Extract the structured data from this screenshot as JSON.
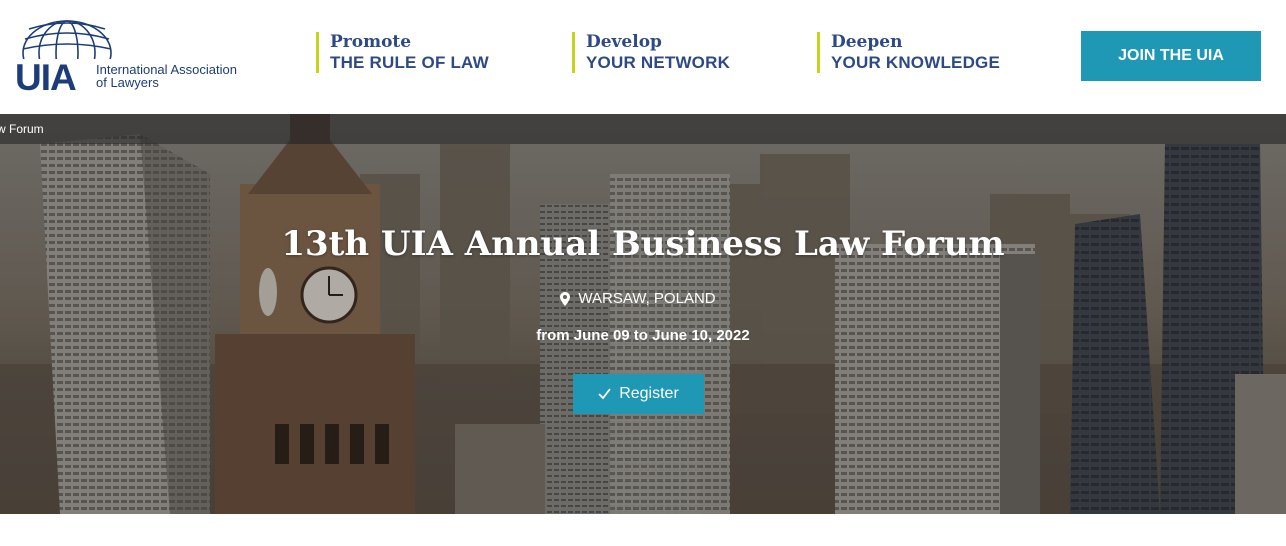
{
  "logo": {
    "acronym": "UIA",
    "name_line1": "International Association",
    "name_line2": "of Lawyers"
  },
  "pillars": [
    {
      "verb": "Promote",
      "object": "THE RULE OF LAW"
    },
    {
      "verb": "Develop",
      "object": "YOUR NETWORK"
    },
    {
      "verb": "Deepen",
      "object": "YOUR KNOWLEDGE"
    }
  ],
  "join_label": "JOIN THE UIA",
  "breadcrumb": "w Forum",
  "event": {
    "title": "13th UIA Annual Business Law Forum",
    "location": "WARSAW, POLAND",
    "dates": "from June 09 to June 10, 2022",
    "register_label": "Register"
  },
  "colors": {
    "brand_navy": "#1d3d79",
    "accent_teal": "#1f98b5",
    "accent_lime": "#c6d41b"
  },
  "icons": [
    "globe-logo-icon",
    "map-pin-icon",
    "checkmark-icon"
  ]
}
